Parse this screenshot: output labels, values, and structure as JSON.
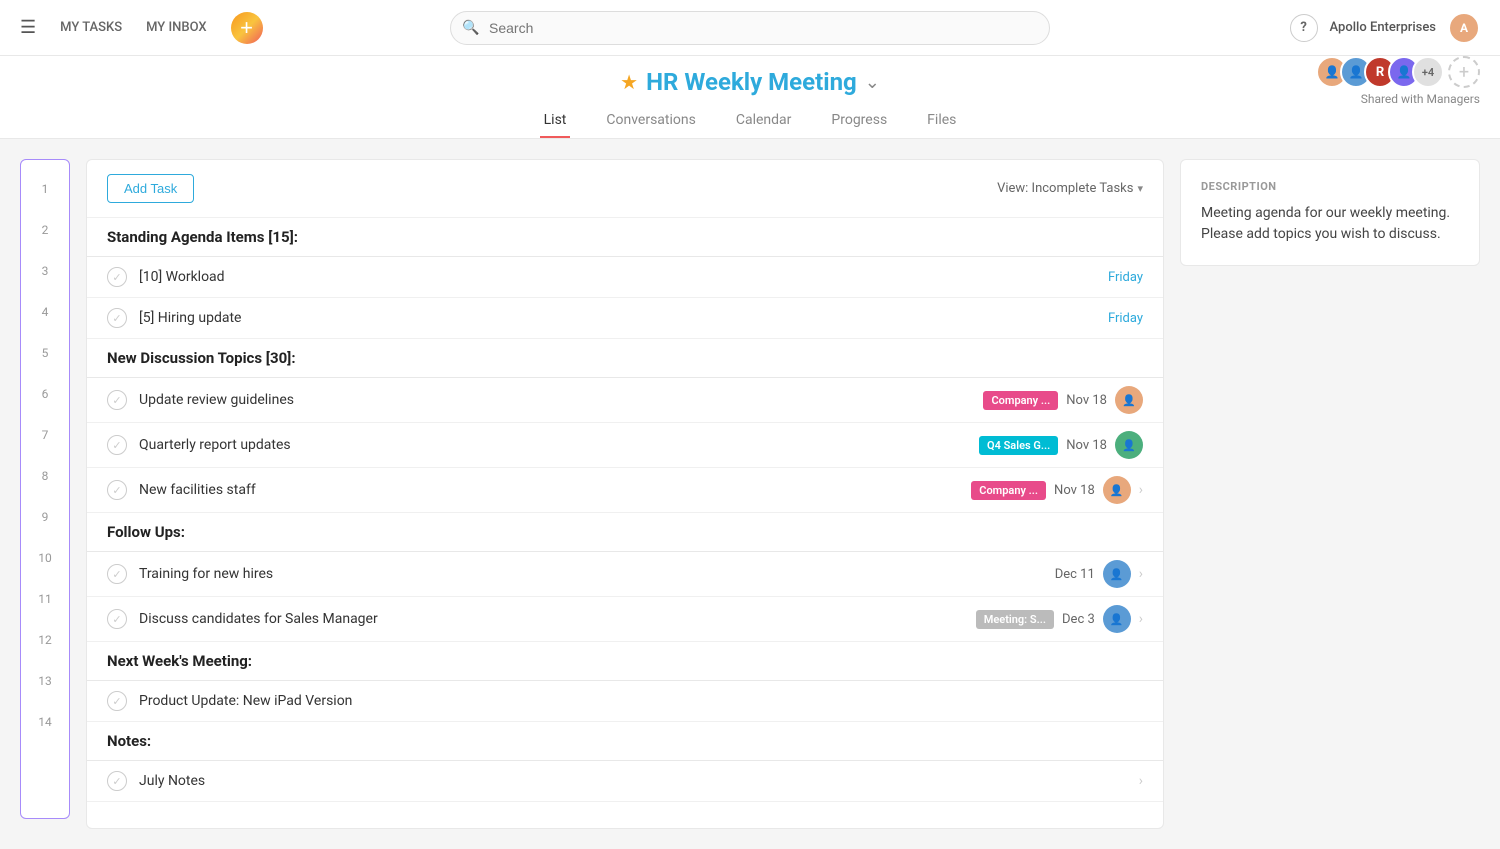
{
  "nav": {
    "my_tasks": "MY TASKS",
    "my_inbox": "MY INBOX",
    "search_placeholder": "Search",
    "workspace": "Apollo Enterprises",
    "help": "?"
  },
  "header": {
    "star": "★",
    "title": "HR Weekly Meeting",
    "caret": "⌄",
    "tabs": [
      "List",
      "Conversations",
      "Calendar",
      "Progress",
      "Files"
    ],
    "active_tab": "List",
    "shared_label": "Shared with Managers"
  },
  "toolbar": {
    "add_task_label": "Add Task",
    "view_label": "View: Incomplete Tasks",
    "view_caret": "▾"
  },
  "description": {
    "title": "DESCRIPTION",
    "body": "Meeting agenda for our weekly meeting. Please add topics you wish to discuss."
  },
  "sections": [
    {
      "type": "section",
      "row": 1,
      "label": "Standing Agenda Items [15]:"
    },
    {
      "type": "task",
      "row": 2,
      "name": "[10] Workload",
      "date": "Friday",
      "date_class": "friday"
    },
    {
      "type": "task",
      "row": 3,
      "name": "[5] Hiring update",
      "date": "Friday",
      "date_class": "friday"
    },
    {
      "type": "section",
      "row": 4,
      "label": "New Discussion Topics [30]:"
    },
    {
      "type": "task",
      "row": 5,
      "name": "Update review guidelines",
      "tag": "Company ...",
      "tag_class": "pink",
      "date": "Nov 18",
      "date_class": "other",
      "avatar_class": "av1",
      "has_chevron": false
    },
    {
      "type": "task",
      "row": 6,
      "name": "Quarterly report updates",
      "tag": "Q4 Sales G...",
      "tag_class": "teal",
      "date": "Nov 18",
      "date_class": "other",
      "avatar_class": "av2",
      "has_chevron": false
    },
    {
      "type": "task",
      "row": 7,
      "name": "New facilities staff",
      "tag": "Company ...",
      "tag_class": "pink",
      "date": "Nov 18",
      "date_class": "other",
      "avatar_class": "av1",
      "has_chevron": true
    },
    {
      "type": "section",
      "row": 8,
      "label": "Follow Ups:"
    },
    {
      "type": "task",
      "row": 9,
      "name": "Training for new hires",
      "date": "Dec 11",
      "date_class": "other",
      "avatar_class": "av3",
      "has_chevron": true
    },
    {
      "type": "task",
      "row": 10,
      "name": "Discuss candidates for Sales Manager",
      "tag": "Meeting: S...",
      "tag_class": "gray",
      "date": "Dec 3",
      "date_class": "other",
      "avatar_class": "av3",
      "has_chevron": true
    },
    {
      "type": "section",
      "row": 11,
      "label": "Next Week's Meeting:"
    },
    {
      "type": "task",
      "row": 12,
      "name": "Product Update: New iPad Version"
    },
    {
      "type": "section",
      "row": 13,
      "label": "Notes:"
    },
    {
      "type": "task",
      "row": 14,
      "name": "July Notes",
      "has_chevron": true
    }
  ]
}
